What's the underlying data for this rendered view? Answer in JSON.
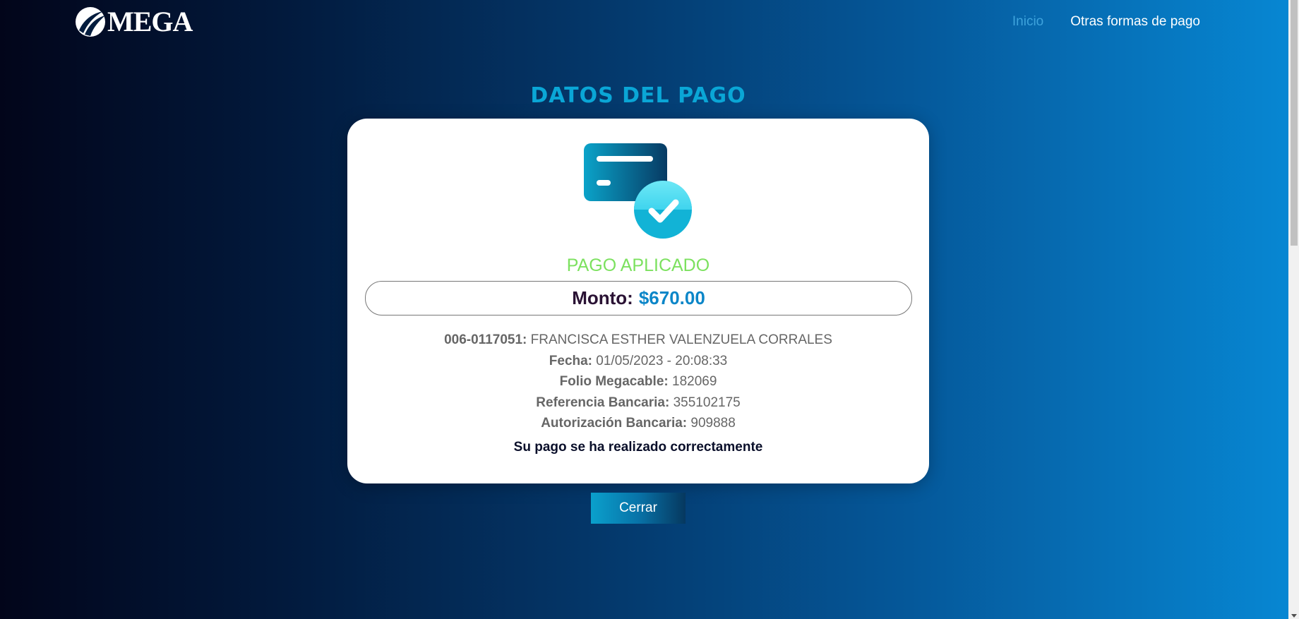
{
  "header": {
    "logo_text": "MEGA",
    "nav": {
      "inicio": "Inicio",
      "otras": "Otras formas de pago"
    }
  },
  "page_title": "DATOS DEL PAGO",
  "card": {
    "status": "PAGO APLICADO",
    "amount_label": "Monto:",
    "amount_value": "$670.00",
    "details": [
      {
        "label": "006-0117051:",
        "value": "FRANCISCA ESTHER VALENZUELA CORRALES"
      },
      {
        "label": "Fecha:",
        "value": "01/05/2023 - 20:08:33"
      },
      {
        "label": "Folio Megacable:",
        "value": "182069"
      },
      {
        "label": "Referencia Bancaria:",
        "value": "355102175"
      },
      {
        "label": "Autorización Bancaria:",
        "value": "909888"
      }
    ],
    "message": "Su pago se ha realizado correctamente"
  },
  "close_button": "Cerrar",
  "colors": {
    "accent_title": "#0aa6d6",
    "status_green": "#7ce15f",
    "amount_blue": "#0b86c8",
    "nav_active": "#3ea3dc"
  },
  "icons": [
    "mega-logo-icon",
    "payment-card-check-icon"
  ]
}
